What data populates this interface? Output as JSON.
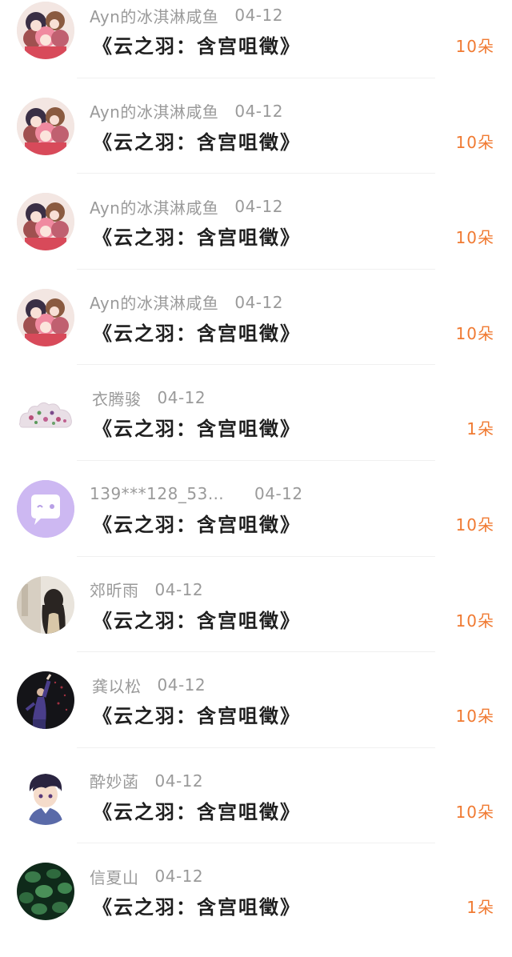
{
  "gift_list": {
    "items": [
      {
        "user": "Ayn的冰淇淋咸鱼",
        "date": "04-12",
        "book": "《云之羽：含宫咀徵》",
        "amount": "10朵",
        "avatar_icon": "anime-girls-group-avatar"
      },
      {
        "user": "Ayn的冰淇淋咸鱼",
        "date": "04-12",
        "book": "《云之羽：含宫咀徵》",
        "amount": "10朵",
        "avatar_icon": "anime-girls-group-avatar"
      },
      {
        "user": "Ayn的冰淇淋咸鱼",
        "date": "04-12",
        "book": "《云之羽：含宫咀徵》",
        "amount": "10朵",
        "avatar_icon": "anime-girls-group-avatar"
      },
      {
        "user": "Ayn的冰淇淋咸鱼",
        "date": "04-12",
        "book": "《云之羽：含宫咀徵》",
        "amount": "10朵",
        "avatar_icon": "anime-girls-group-avatar"
      },
      {
        "user": "衣腾骏",
        "date": "04-12",
        "book": "《云之羽：含宫咀徵》",
        "amount": "1朵",
        "avatar_icon": "flower-cloud-avatar"
      },
      {
        "user": "139***128_53…",
        "date": "04-12",
        "book": "《云之羽：含宫咀徵》",
        "amount": "10朵",
        "avatar_icon": "purple-chat-bubble-avatar"
      },
      {
        "user": "郊昕雨",
        "date": "04-12",
        "book": "《云之羽：含宫咀徵》",
        "amount": "10朵",
        "avatar_icon": "girl-photo-avatar"
      },
      {
        "user": "龚以松",
        "date": "04-12",
        "book": "《云之羽：含宫咀徵》",
        "amount": "10朵",
        "avatar_icon": "dancer-photo-avatar"
      },
      {
        "user": "酔妙菡",
        "date": "04-12",
        "book": "《云之羽：含宫咀徵》",
        "amount": "10朵",
        "avatar_icon": "anime-boy-avatar"
      },
      {
        "user": "信夏山",
        "date": "04-12",
        "book": "《云之羽：含宫咀徵》",
        "amount": "1朵",
        "avatar_icon": "green-leaves-avatar"
      }
    ]
  },
  "colors": {
    "amount": "#f07a32",
    "meta_text": "#9a9a9a",
    "title_text": "#1f1f1f",
    "divider": "#f0f0f0"
  }
}
